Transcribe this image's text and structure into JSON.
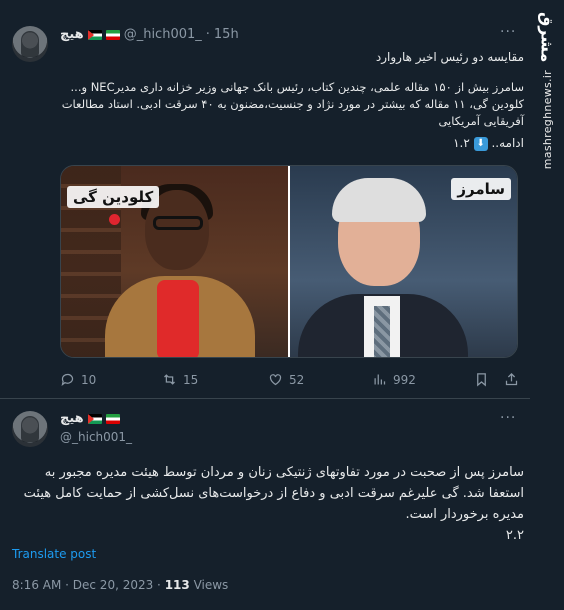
{
  "tweet1": {
    "display_name": "هیچ",
    "handle": "@_hich001_",
    "dot": "·",
    "time": "15h",
    "more": "···",
    "title": "مقایسه دو رئیس اخیر هاروارد",
    "body_line1": "سامرز بیش از ۱۵۰ مقاله علمی، چندین کتاب، رئیس بانک جهانی وزیر خزانه داری مدیرNEC و...",
    "body_line2": "کلودین گی، ۱۱ مقاله که بیشتر در مورد نژاد و جنسیت،مضنون به ۴۰ سرقت ادبی. استاد مطالعات آفریقایی آمریکایی",
    "more_text": "ادامه..",
    "thread_index": "۱.۲",
    "image_label_left": "کلودین گی",
    "image_label_right": "سامرز",
    "stats": {
      "replies": "10",
      "retweets": "15",
      "likes": "52",
      "views": "992"
    }
  },
  "tweet2": {
    "display_name": "هیچ",
    "handle": "@_hich001_",
    "more": "···",
    "body": "سامرز پس از صحبت در مورد تفاوتهای ژنتیکی زنان و مردان توسط هیئت مدیره مجبور به استعفا شد. گی علیرغم سرقت ادبی و دفاع از درخواست‌های نسل‌کشی از حمایت کامل هیئت مدیره برخوردار است.",
    "thread_index": "۲.۲",
    "translate": "Translate post",
    "timestamp": "8:16 AM · Dec 20, 2023 · ",
    "views_count": "113",
    "views_label": " Views"
  },
  "watermark": {
    "logo": "مشرق",
    "text": "mashreghnews.ir"
  },
  "colors": {
    "background": "#15202b",
    "text": "#e7e9ea",
    "muted": "#8b98a5",
    "link": "#1d9bf0",
    "border": "#38444d"
  },
  "icons": [
    "reply-icon",
    "retweet-icon",
    "like-icon",
    "views-icon",
    "bookmark-icon",
    "share-icon"
  ]
}
